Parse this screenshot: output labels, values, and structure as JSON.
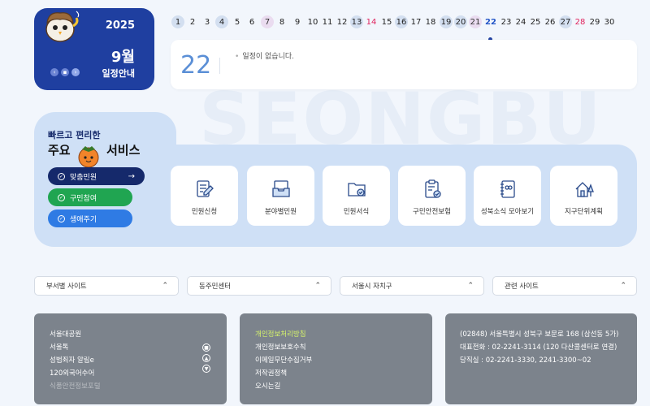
{
  "calendar": {
    "year": "2025",
    "month": "9월",
    "title": "일정안내",
    "days": [
      "1",
      "2",
      "3",
      "4",
      "5",
      "6",
      "7",
      "8",
      "9",
      "10",
      "11",
      "12",
      "13",
      "14",
      "15",
      "16",
      "17",
      "18",
      "19",
      "20",
      "21",
      "22",
      "23",
      "24",
      "25",
      "26",
      "27",
      "28",
      "29",
      "30"
    ],
    "selected_day": "22",
    "empty_message": "일정이 없습니다."
  },
  "watermark": "SEONGBU",
  "services": {
    "subtitle": "빠르고 편리한",
    "title_a": "주요",
    "title_b": "서비스",
    "pills": [
      {
        "label": "맞춤민원"
      },
      {
        "label": "구민참여"
      },
      {
        "label": "생애주기"
      }
    ],
    "cards": [
      {
        "label": "민원신청",
        "icon": "document-pen-icon"
      },
      {
        "label": "분야별민원",
        "icon": "inbox-tray-icon"
      },
      {
        "label": "민원서식",
        "icon": "folder-check-icon"
      },
      {
        "label": "구민안전보험",
        "icon": "clipboard-check-icon"
      },
      {
        "label": "성북소식 모아보기",
        "icon": "notebook-icon"
      },
      {
        "label": "지구단위계획",
        "icon": "house-tree-icon"
      }
    ]
  },
  "dropdowns": [
    {
      "label": "부서별 사이트"
    },
    {
      "label": "동주민센터"
    },
    {
      "label": "서울시 자치구"
    },
    {
      "label": "관련 사이트"
    }
  ],
  "footer": {
    "links_left": [
      "서울대공원",
      "서울톡",
      "성범죄자 알림e",
      "120외국어수어",
      "식품안전정보포털"
    ],
    "links_mid": [
      "개인정보처리방침",
      "개인정보보호수칙",
      "이메일무단수집거부",
      "저작권정책",
      "오시는길"
    ],
    "address": "(02848) 서울특별시 성북구 보문로 168 (삼선동 5가)",
    "phone": "대표전화 : 02-2241-3114 (120 다산콜센터로 연결)",
    "night": "당직실 : 02-2241-3330, 2241-3300~02"
  }
}
